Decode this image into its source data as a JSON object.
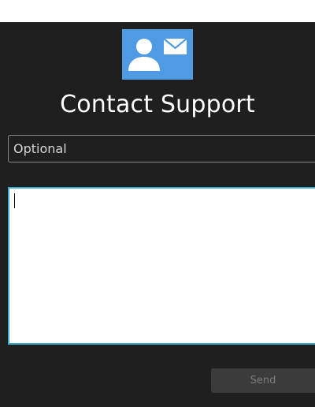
{
  "header": {
    "title": "Contact Support"
  },
  "form": {
    "subject_placeholder": "Optional",
    "subject_value": "",
    "message_value": "",
    "send_label": "Send"
  },
  "icons": {
    "app_logo": "contact-support-icon"
  },
  "colors": {
    "panel_background": "#1f1f1f",
    "logo_background": "#4f9be3",
    "focus_border": "#3aa9d0",
    "button_background": "#3b3b3b",
    "button_text": "#7c7c7c"
  }
}
